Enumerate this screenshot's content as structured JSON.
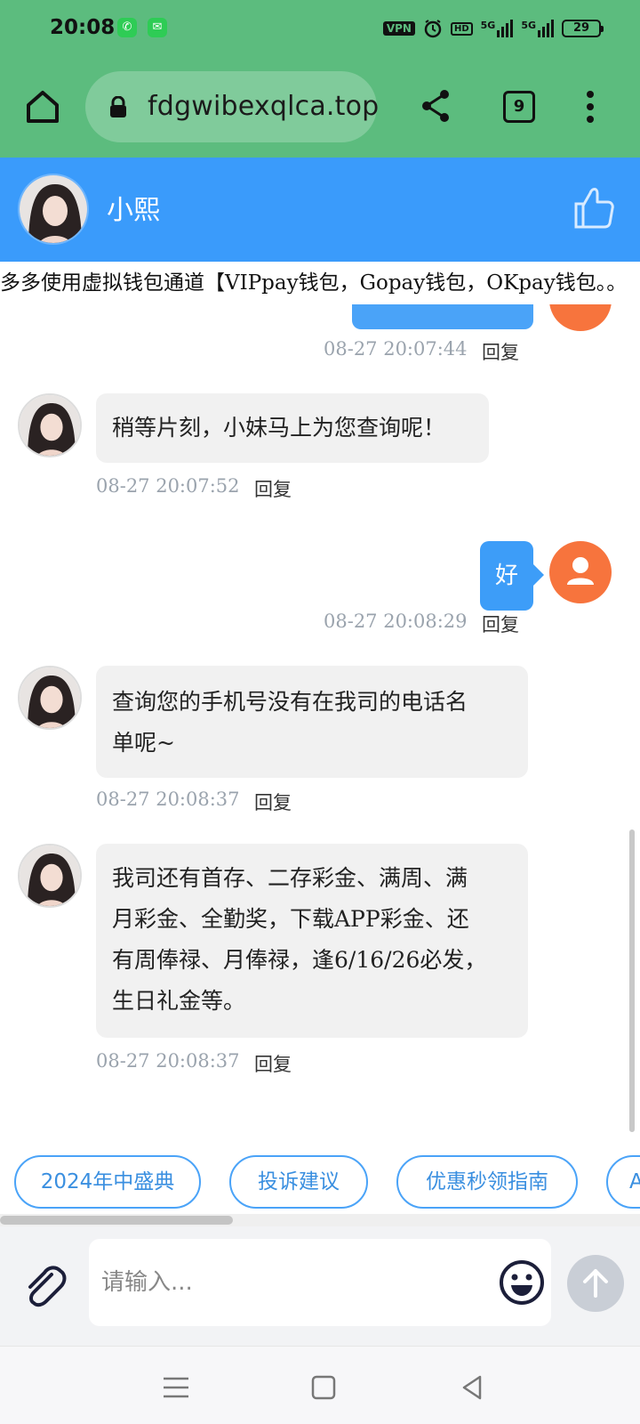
{
  "status_bar": {
    "time": "20:08",
    "vpn_label": "VPN",
    "hd_label": "HD",
    "signal_1": "5G",
    "signal_2": "5G",
    "battery": "29",
    "app_icons": [
      "phone-icon",
      "message-icon"
    ]
  },
  "browser": {
    "url": "fdgwibexqlca.top",
    "tab_count": "9"
  },
  "chat": {
    "agent_name": "小熙",
    "marquee_text": "多多使用虚拟钱包通道【VIPpay钱包，Gopay钱包，OKpay钱包。。",
    "reply_label": "回复",
    "top_time": "08-27 20:07:44",
    "messages": [
      {
        "from": "agent",
        "lines": [
          "稍等片刻，小妹马上为您查询呢！"
        ],
        "time": "08-27 20:07:52"
      },
      {
        "from": "user",
        "lines": [
          "好"
        ],
        "time": "08-27 20:08:29"
      },
      {
        "from": "agent",
        "lines": [
          "查询您的手机号没有在我司的电话名",
          "单呢~"
        ],
        "time": "08-27 20:08:37"
      },
      {
        "from": "agent",
        "lines": [
          "我司还有首存、二存彩金、满周、满",
          "月彩金、全勤奖，下载APP彩金、还",
          "有周俸禄、月俸禄，逢6/16/26必发，",
          "生日礼金等。"
        ],
        "time": "08-27 20:08:37"
      }
    ]
  },
  "quick_replies": [
    "2024年中盛典",
    "投诉建议",
    "优惠秒领指南",
    "A"
  ],
  "input": {
    "placeholder": "请输入..."
  },
  "colors": {
    "browser_bar": "#5cbc7e",
    "header": "#3a9bfb",
    "user_bubble": "#3d9df8",
    "user_avatar": "#f7743d",
    "agent_bubble": "#f1f1f1"
  }
}
